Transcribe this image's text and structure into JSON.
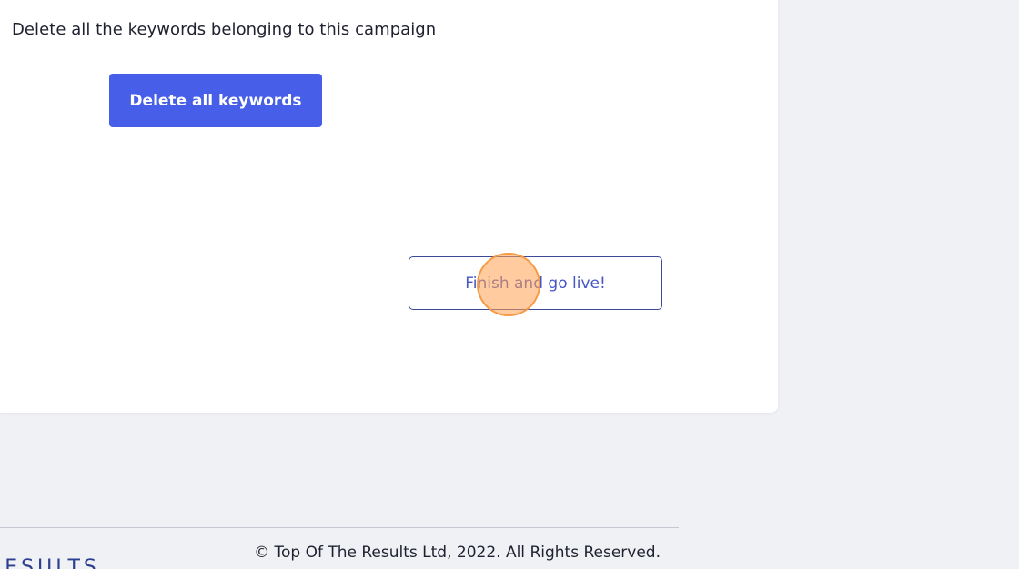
{
  "campaign_card": {
    "description": "Delete all the keywords belonging to this campaign",
    "delete_button_label": "Delete all keywords",
    "finish_button_label": "Finish and go live!"
  },
  "footer": {
    "logo_text": "RESULTS",
    "copyright": "© Top Of The Results Ltd, 2022. All Rights Reserved."
  },
  "colors": {
    "page_background": "#eff1f5",
    "card_background": "#ffffff",
    "primary": "#475fe8",
    "outline_button_border": "#3a4a96",
    "click_marker": "#f5963c"
  }
}
